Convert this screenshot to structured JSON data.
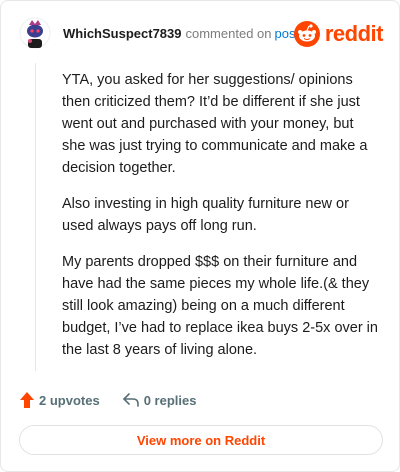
{
  "header": {
    "username": "WhichSuspect7839",
    "commented_on": "commented on",
    "post_link": "post",
    "logo_text": "reddit"
  },
  "comment": {
    "paragraphs": [
      "YTA, you asked for her suggestions/ opinions then criticized them? It’d be different if she just went out and purchased with your money, but she was just trying to communicate and make a decision together.",
      "Also investing in high quality furniture new or used always pays off long run.",
      "My parents dropped $$$ on their furniture and have had the same pieces my whole life.(& they still look amazing) being on a much different budget, I’ve had to replace ikea buys 2-5x over in the last 8 years of living alone."
    ]
  },
  "actions": {
    "upvotes_label": "2 upvotes",
    "replies_label": "0 replies"
  },
  "footer": {
    "view_more_label": "View more on Reddit"
  },
  "colors": {
    "brand": "#ff4500",
    "link": "#0079d3"
  }
}
